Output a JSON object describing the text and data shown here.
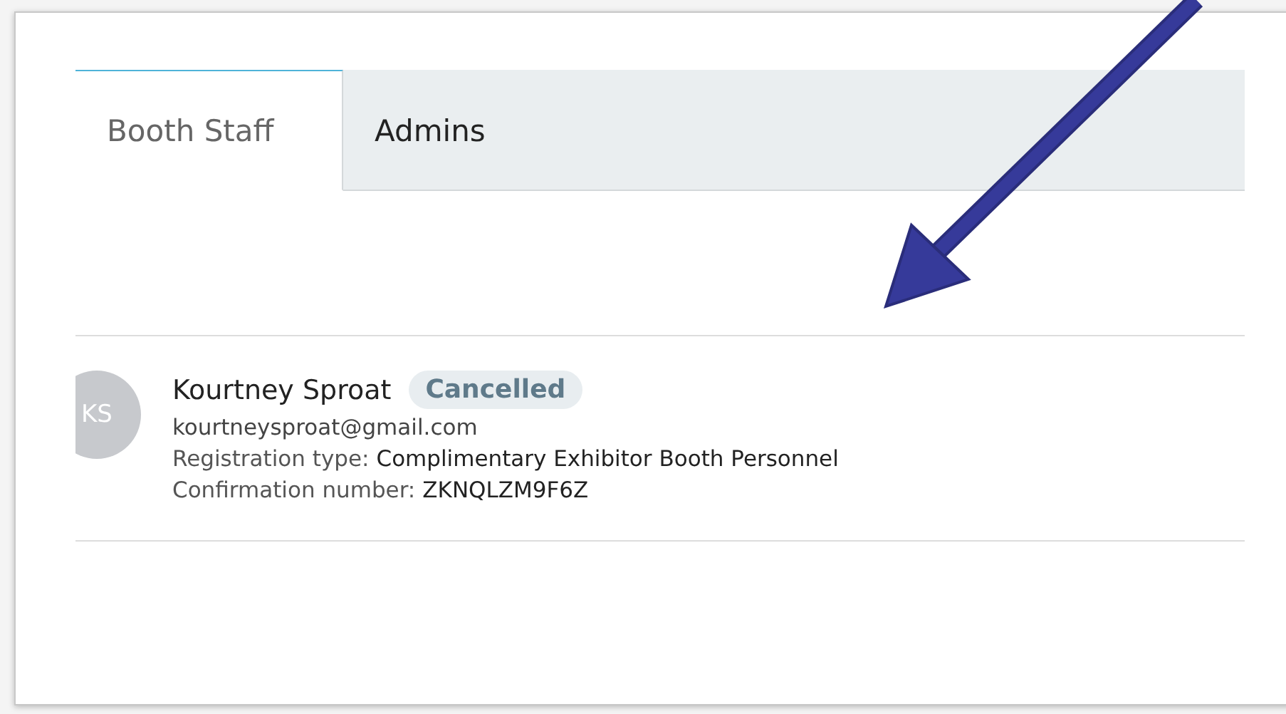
{
  "tabs": [
    {
      "label": "Booth Staff",
      "selected": true
    },
    {
      "label": "Admins",
      "selected": false
    }
  ],
  "staff": [
    {
      "initials": "KS",
      "name": "Kourtney Sproat",
      "status": "Cancelled",
      "email": "kourtneysproat@gmail.com",
      "fields": [
        {
          "label": "Registration type:",
          "value": "Complimentary Exhibitor Booth Personnel"
        },
        {
          "label": "Confirmation number:",
          "value": "ZKNQLZM9F6Z"
        }
      ]
    }
  ]
}
